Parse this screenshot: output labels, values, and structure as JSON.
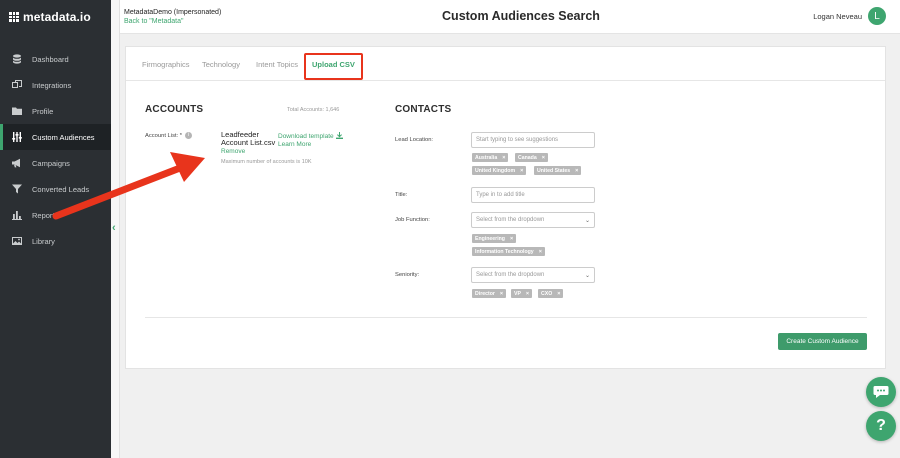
{
  "app": {
    "logo_text": "metadata.io"
  },
  "header": {
    "impersonation": "MetadataDemo (Impersonated)",
    "back_link": "Back to \"Metadata\"",
    "title": "Custom Audiences Search",
    "user_name": "Logan Neveau",
    "avatar_initial": "L"
  },
  "sidebar": {
    "items": [
      {
        "label": "Dashboard",
        "icon": "database-icon",
        "active": false
      },
      {
        "label": "Integrations",
        "icon": "integrations-icon",
        "active": false
      },
      {
        "label": "Profile",
        "icon": "folder-icon",
        "active": false
      },
      {
        "label": "Custom Audiences",
        "icon": "sliders-icon",
        "active": true
      },
      {
        "label": "Campaigns",
        "icon": "megaphone-icon",
        "active": false
      },
      {
        "label": "Converted Leads",
        "icon": "filter-icon",
        "active": false
      },
      {
        "label": "Reports",
        "icon": "bar-chart-icon",
        "active": false
      },
      {
        "label": "Library",
        "icon": "image-icon",
        "active": false
      }
    ]
  },
  "tabs": [
    "Firmographics",
    "Technology",
    "Intent Topics",
    "Upload CSV"
  ],
  "accounts": {
    "title": "ACCOUNTS",
    "total": "Total Accounts: 1,646",
    "list_label": "Account List: *",
    "filename": "Leadfeeder Account List.csv",
    "remove": "Remove",
    "download": "Download template",
    "learn_more": "Learn More",
    "max_note": "Maximum number of accounts is 10K"
  },
  "contacts": {
    "title": "CONTACTS",
    "lead_location": {
      "label": "Lead Location:",
      "placeholder": "Start typing to see suggestions",
      "tags": [
        "Australia",
        "Canada",
        "United Kingdom",
        "United States"
      ]
    },
    "title_field": {
      "label": "Title:",
      "placeholder": "Type in to add title"
    },
    "job_function": {
      "label": "Job Function:",
      "placeholder": "Select from the dropdown",
      "tags": [
        "Engineering",
        "Information Technology"
      ]
    },
    "seniority": {
      "label": "Seniority:",
      "placeholder": "Select from the dropdown",
      "tags": [
        "Director",
        "VP",
        "CXO"
      ]
    }
  },
  "create_button": "Create Custom Audience",
  "help_label": "?",
  "tag_close": "×",
  "colors": {
    "brand": "#3ea56f",
    "sidebar": "#2b2f33",
    "annotation": "#e8341c"
  }
}
